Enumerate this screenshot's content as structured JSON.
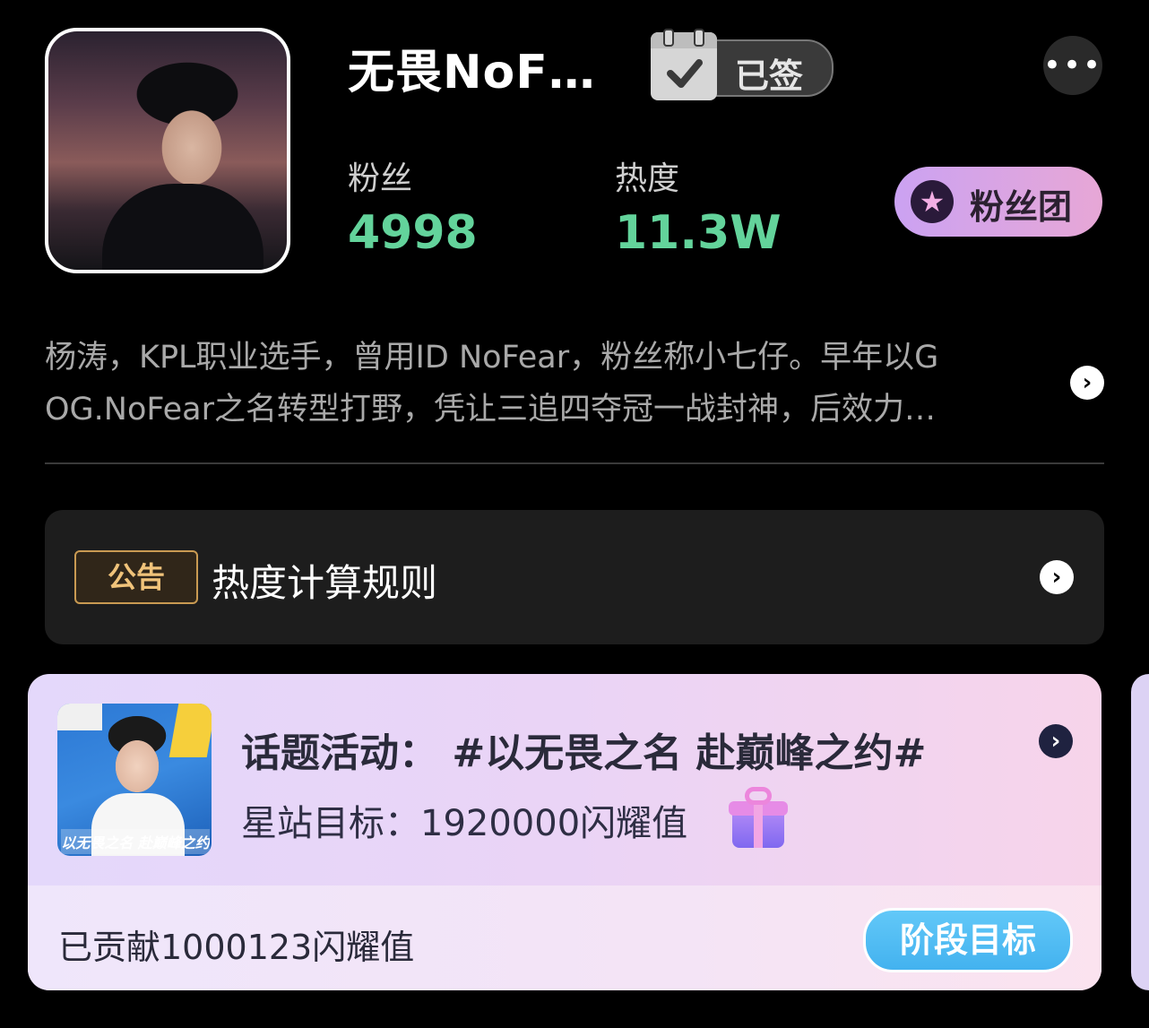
{
  "profile": {
    "name": "无畏NoF…",
    "sign_status": "已签",
    "fans_label": "粉丝",
    "fans_value": "4998",
    "heat_label": "热度",
    "heat_value": "11.3W",
    "fan_club_label": "粉丝团",
    "bio_line1": "杨涛，KPL职业选手，曾用ID NoFear，粉丝称小七仔。早年以G",
    "bio_line2": "OG.NoFear之名转型打野，凭让三追四夺冠一战封神，后效力…"
  },
  "notice": {
    "tag": "公告",
    "title": "热度计算规则"
  },
  "activity": {
    "topic": "话题活动：  #以无畏之名 赴巅峰之约#",
    "goal": "星站目标：1920000闪耀值",
    "contributed": "已贡献1000123闪耀值",
    "stage_button": "阶段目标",
    "thumb_caption": "以无畏之名 赴巅峰之约"
  },
  "colors": {
    "accent_green": "#63d39b",
    "notice_gold": "#f0c37a",
    "stage_blue": "#43b2ef"
  }
}
